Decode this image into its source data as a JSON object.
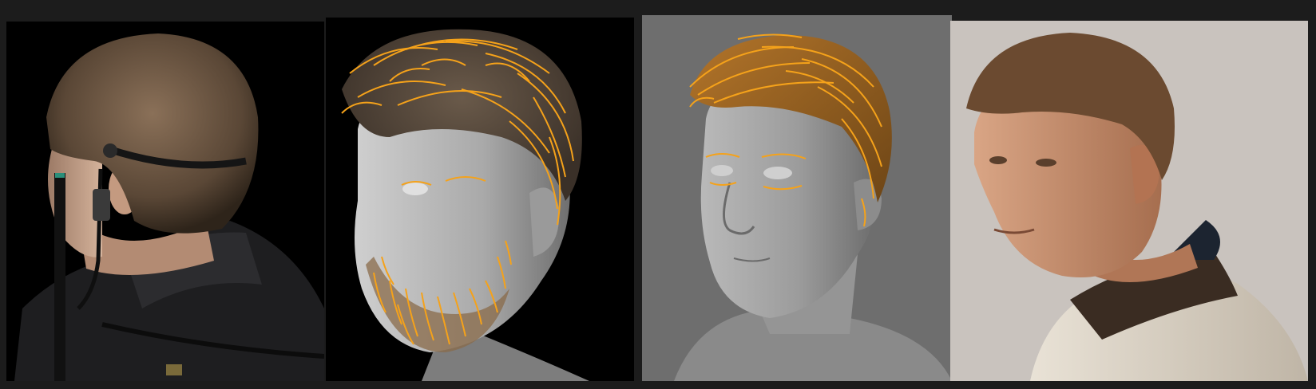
{
  "panels": [
    {
      "id": "p1",
      "depicts": "photo-back-of-head-with-headset-mic",
      "bg": "#000000"
    },
    {
      "id": "p2",
      "depicts": "cg-render-head-with-hair-guides",
      "bg": "#000000",
      "accent": "#f5a21a"
    },
    {
      "id": "p3",
      "depicts": "grey-clay-head-with-hair-guides",
      "bg": "#6e6e6e",
      "accent": "#f5a21a"
    },
    {
      "id": "p4",
      "depicts": "photo-man-in-jacket-profile",
      "bg": "#c9c3be"
    }
  ]
}
